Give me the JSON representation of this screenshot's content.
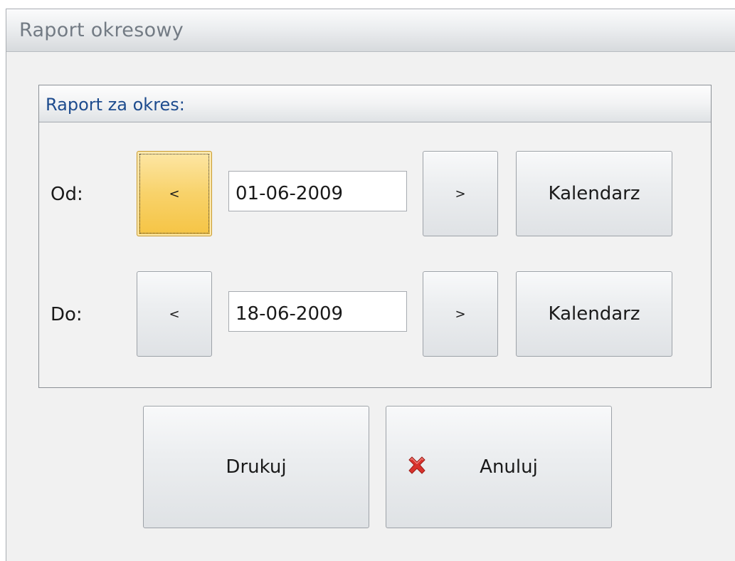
{
  "window": {
    "title": "Raport okresowy"
  },
  "group": {
    "title": "Raport za okres:"
  },
  "from_row": {
    "label": "Od:",
    "prev_label": "<",
    "date_value": "01-06-2009",
    "next_label": ">",
    "calendar_label": "Kalendarz"
  },
  "to_row": {
    "label": "Do:",
    "prev_label": "<",
    "date_value": "18-06-2009",
    "next_label": ">",
    "calendar_label": "Kalendarz"
  },
  "actions": {
    "print_label": "Drukuj",
    "cancel_label": "Anuluj"
  },
  "icons": {
    "cancel_icon": "close-icon",
    "cancel_icon_color": "#d8322c"
  },
  "colors": {
    "focus_button": "#f5c444",
    "group_title": "#1e4c8e",
    "window_title": "#737b84"
  }
}
